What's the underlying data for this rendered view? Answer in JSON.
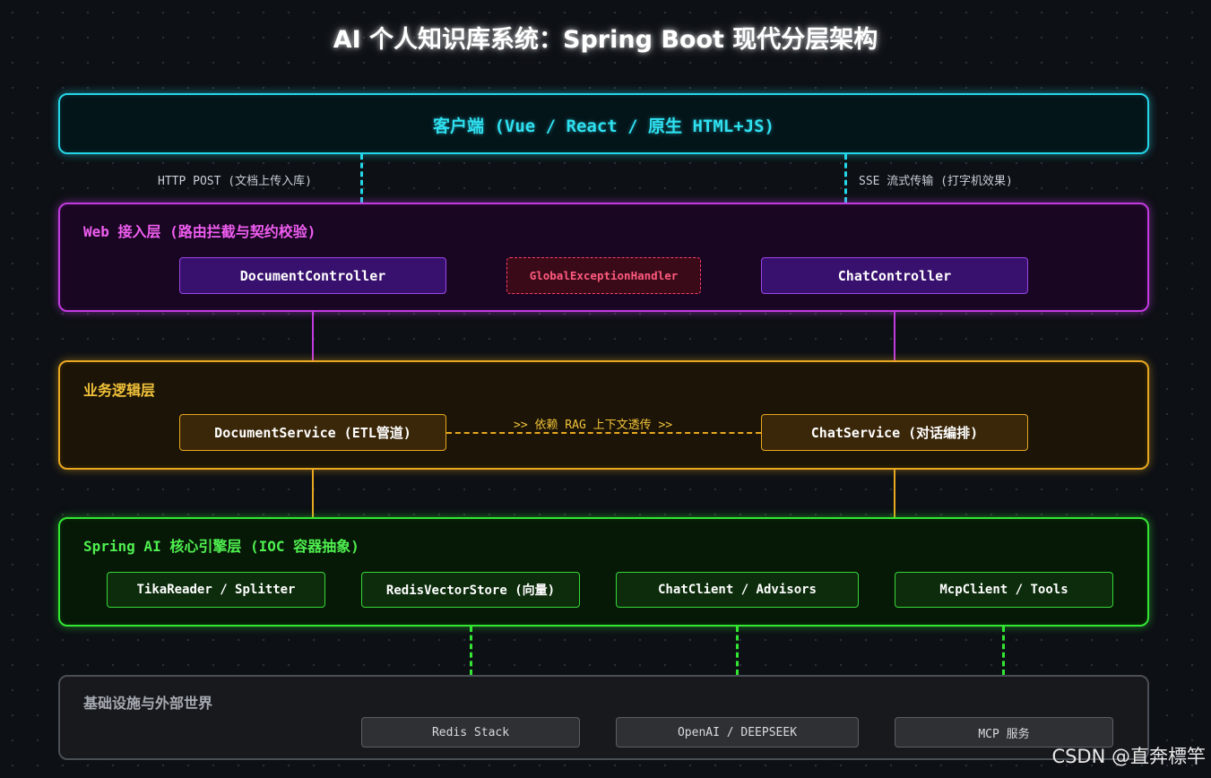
{
  "title": "AI 个人知识库系统：Spring Boot 现代分层架构",
  "client": {
    "label": "客户端 (Vue / React / 原生 HTML+JS)"
  },
  "connections": {
    "left_label": "HTTP POST (文档上传入库)",
    "right_label": "SSE 流式传输 (打字机效果)",
    "biz_link_label": ">> 依赖 RAG 上下文透传 >>"
  },
  "web_layer": {
    "title": "Web 接入层 (路由拦截与契约校验)",
    "nodes": [
      "DocumentController",
      "GlobalExceptionHandler",
      "ChatController"
    ]
  },
  "business_layer": {
    "title": "业务逻辑层",
    "nodes": [
      "DocumentService (ETL管道)",
      "ChatService (对话编排)"
    ]
  },
  "spring_ai_layer": {
    "title": "Spring AI 核心引擎层 (IOC 容器抽象)",
    "nodes": [
      "TikaReader / Splitter",
      "RedisVectorStore (向量)",
      "ChatClient / Advisors",
      "McpClient / Tools"
    ]
  },
  "infra_layer": {
    "title": "基础设施与外部世界",
    "nodes": [
      "Redis Stack",
      "OpenAI / DEEPSEEK",
      "MCP 服务"
    ]
  },
  "watermark": "CSDN @直奔標竿",
  "colors": {
    "client": "#25d6e8",
    "web": "#c13be0",
    "business": "#e8a820",
    "spring_ai": "#33e633",
    "infra": "#4a4e55",
    "error": "#ff3f6a"
  }
}
